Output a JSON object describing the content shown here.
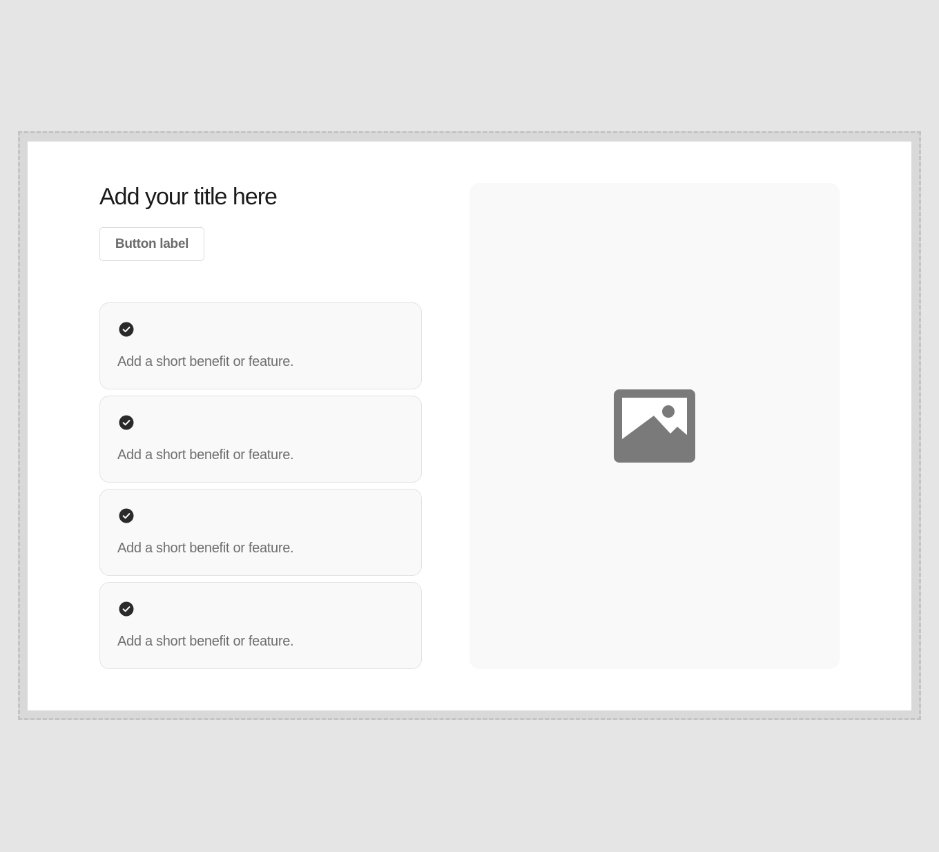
{
  "hero": {
    "title": "Add your title here",
    "button_label": "Button label"
  },
  "features": [
    {
      "text": "Add a short benefit or feature.",
      "icon": "check-circle-icon"
    },
    {
      "text": "Add a short benefit or feature.",
      "icon": "check-circle-icon"
    },
    {
      "text": "Add a short benefit or feature.",
      "icon": "check-circle-icon"
    },
    {
      "text": "Add a short benefit or feature.",
      "icon": "check-circle-icon"
    }
  ],
  "media": {
    "icon": "image-placeholder-icon"
  },
  "colors": {
    "page_background": "#e5e5e5",
    "canvas_background": "#ffffff",
    "card_background": "#f9f9f9",
    "title_text": "#1a1a1a",
    "body_text": "#6f6f6f",
    "icon_fill": "#7a7a7a"
  }
}
